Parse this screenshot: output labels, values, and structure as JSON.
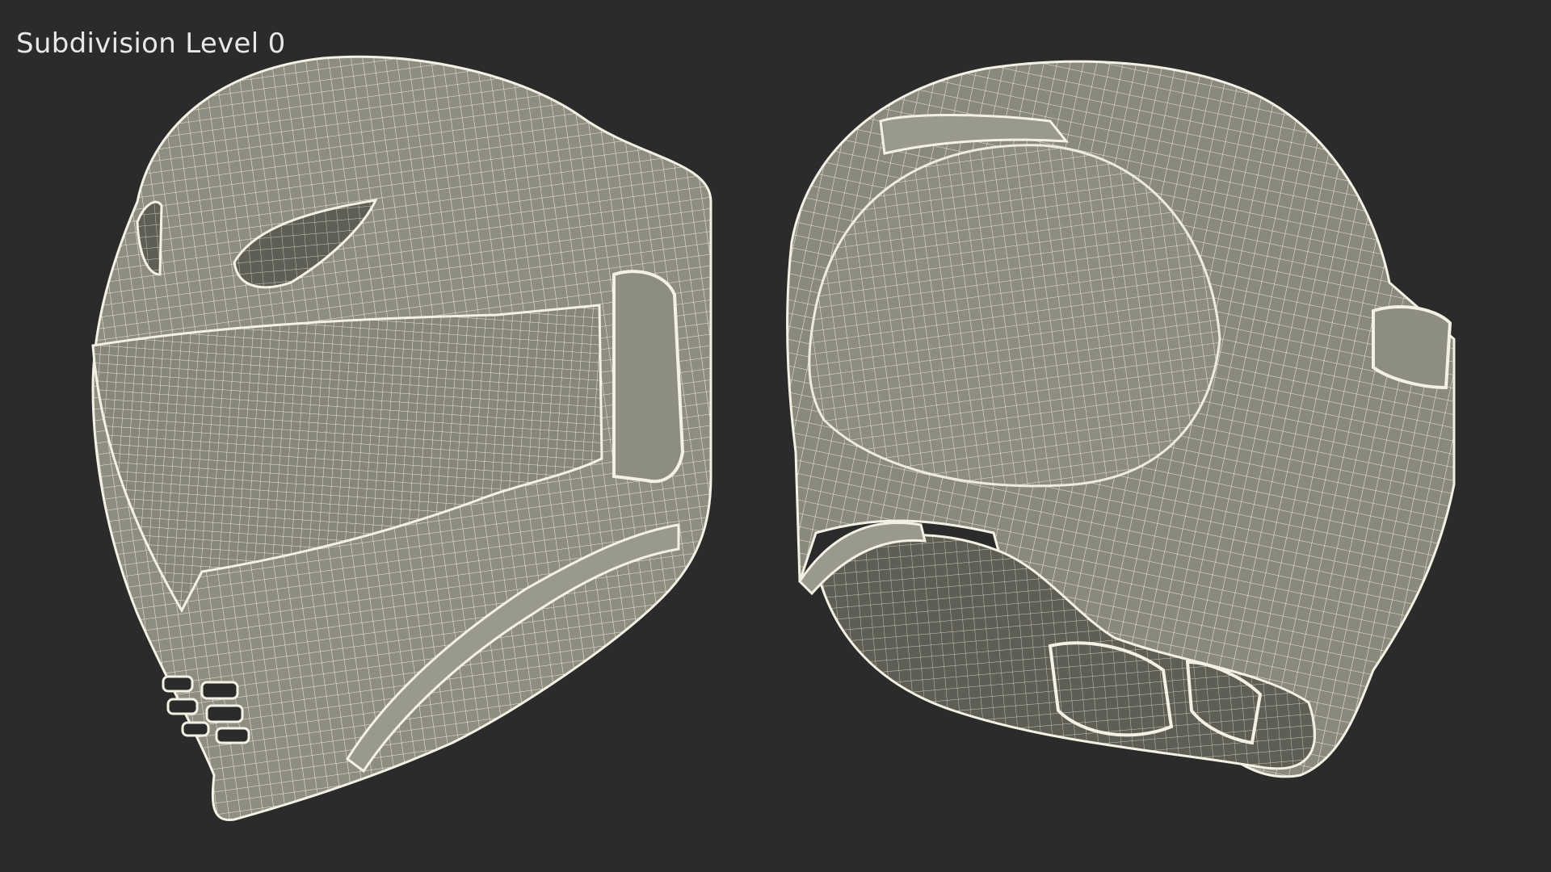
{
  "viewport": {
    "label": "Subdivision Level 0",
    "background_color": "#2b2b2b",
    "mesh_fill_color": "#8e8e80",
    "wire_color": "#f3f1e3"
  },
  "models": [
    {
      "name": "helmet-front-three-quarter-view",
      "description_icon": "helmet-icon"
    },
    {
      "name": "helmet-rear-three-quarter-view",
      "description_icon": "helmet-icon"
    }
  ]
}
